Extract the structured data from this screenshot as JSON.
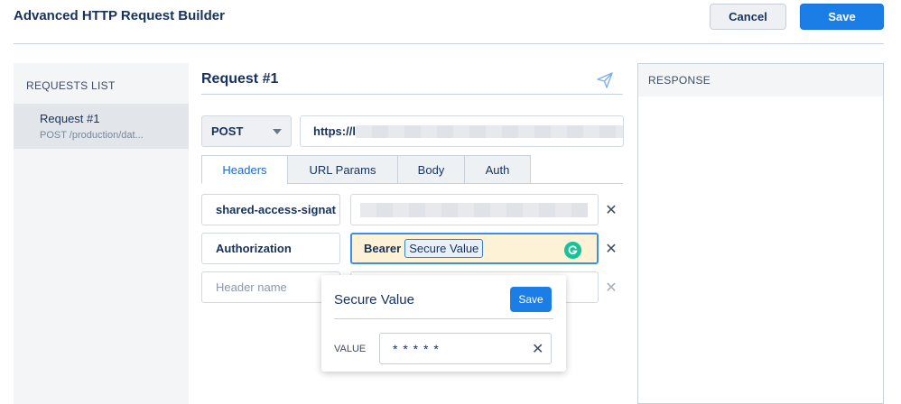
{
  "app": {
    "title": "Advanced HTTP Request Builder"
  },
  "toolbar": {
    "cancel_label": "Cancel",
    "save_label": "Save"
  },
  "requests_list": {
    "heading": "REQUESTS LIST",
    "items": [
      {
        "name": "Request #1",
        "subtitle": "POST /production/dat..."
      }
    ]
  },
  "request": {
    "title": "Request #1",
    "method": "POST",
    "url_prefix": "https://l",
    "tabs": [
      {
        "label": "Headers",
        "active": true
      },
      {
        "label": "URL Params",
        "active": false
      },
      {
        "label": "Body",
        "active": false
      },
      {
        "label": "Auth",
        "active": false
      }
    ],
    "headers": [
      {
        "name": "shared-access-signat",
        "value": ""
      },
      {
        "name": "Authorization",
        "value_prefix": "Bearer",
        "token": "Secure Value"
      },
      {
        "name_placeholder": "Header name"
      }
    ]
  },
  "popover": {
    "title": "Secure Value",
    "save_label": "Save",
    "value_label": "VALUE",
    "value": "* * * * *"
  },
  "response": {
    "heading": "RESPONSE"
  },
  "icons": {
    "send": "paper-plane-icon",
    "close": "close-icon",
    "grammarly": "grammarly-icon",
    "dropdown": "chevron-down-icon"
  },
  "colors": {
    "accent": "#1b7de6",
    "text": "#16325c",
    "highlight": "#fdf2d6",
    "grammarly": "#15c39a"
  }
}
